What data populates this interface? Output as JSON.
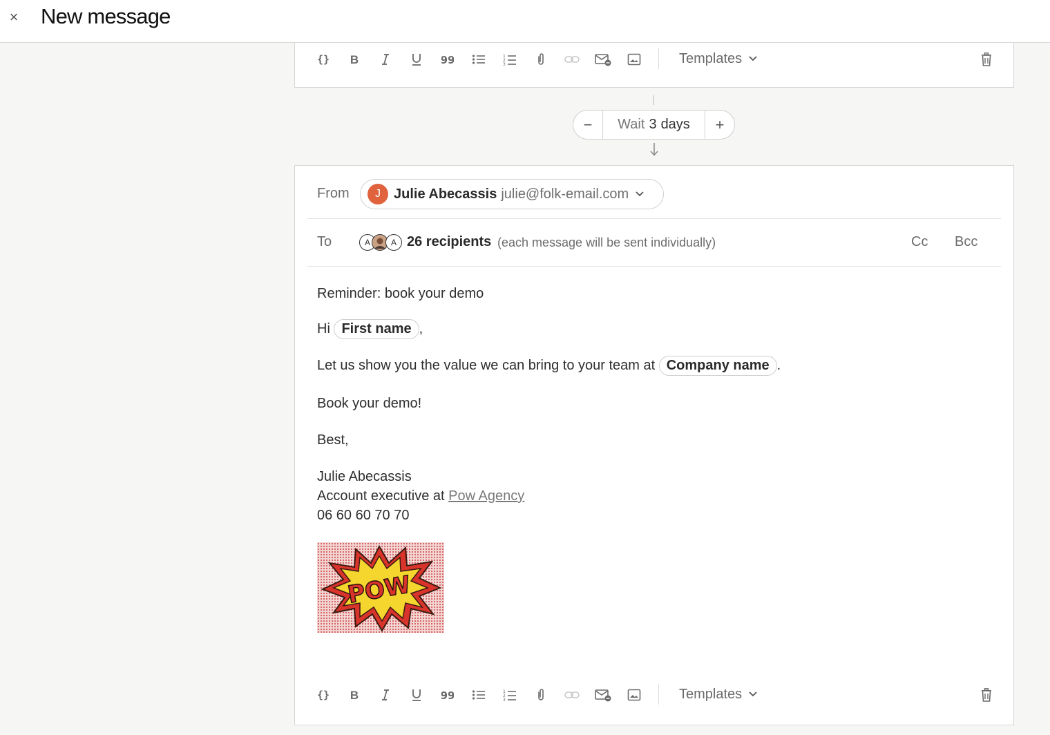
{
  "header": {
    "close_glyph": "×",
    "title": "New message"
  },
  "toolbar": {
    "templates_label": "Templates",
    "icons": [
      "variables-icon",
      "bold-icon",
      "italic-icon",
      "underline-icon",
      "quote-icon",
      "bulleted-list-icon",
      "numbered-list-icon",
      "attachment-icon",
      "link-icon",
      "signature-icon",
      "image-icon",
      "trash-icon"
    ]
  },
  "wait": {
    "minus": "−",
    "prefix": "Wait",
    "number": "3",
    "unit": "days",
    "plus": "+"
  },
  "from": {
    "label": "From",
    "avatar_initial": "J",
    "name": "Julie Abecassis",
    "email": "julie@folk-email.com"
  },
  "to": {
    "label": "To",
    "avatar_letters": [
      "A",
      "A"
    ],
    "count_text": "26 recipients",
    "note": "(each message will be sent individually)",
    "cc": "Cc",
    "bcc": "Bcc"
  },
  "message": {
    "subject": "Reminder: book your demo",
    "greeting_prefix": "Hi",
    "first_name_var": "First name",
    "greeting_suffix": ",",
    "value_line_prefix": "Let us show you the value we can bring to your team at",
    "company_var": "Company name",
    "value_line_suffix": ".",
    "cta": "Book your demo!",
    "closing": "Best,",
    "signature_name": "Julie Abecassis",
    "signature_role_prefix": "Account executive at",
    "signature_company_link": "Pow Agency",
    "signature_phone": "06 60 60 70 70",
    "image_text": "POW"
  },
  "colors": {
    "avatar_orange": "#e0633e",
    "pow_yellow": "#f5d62e",
    "pow_red": "#d9342b"
  }
}
